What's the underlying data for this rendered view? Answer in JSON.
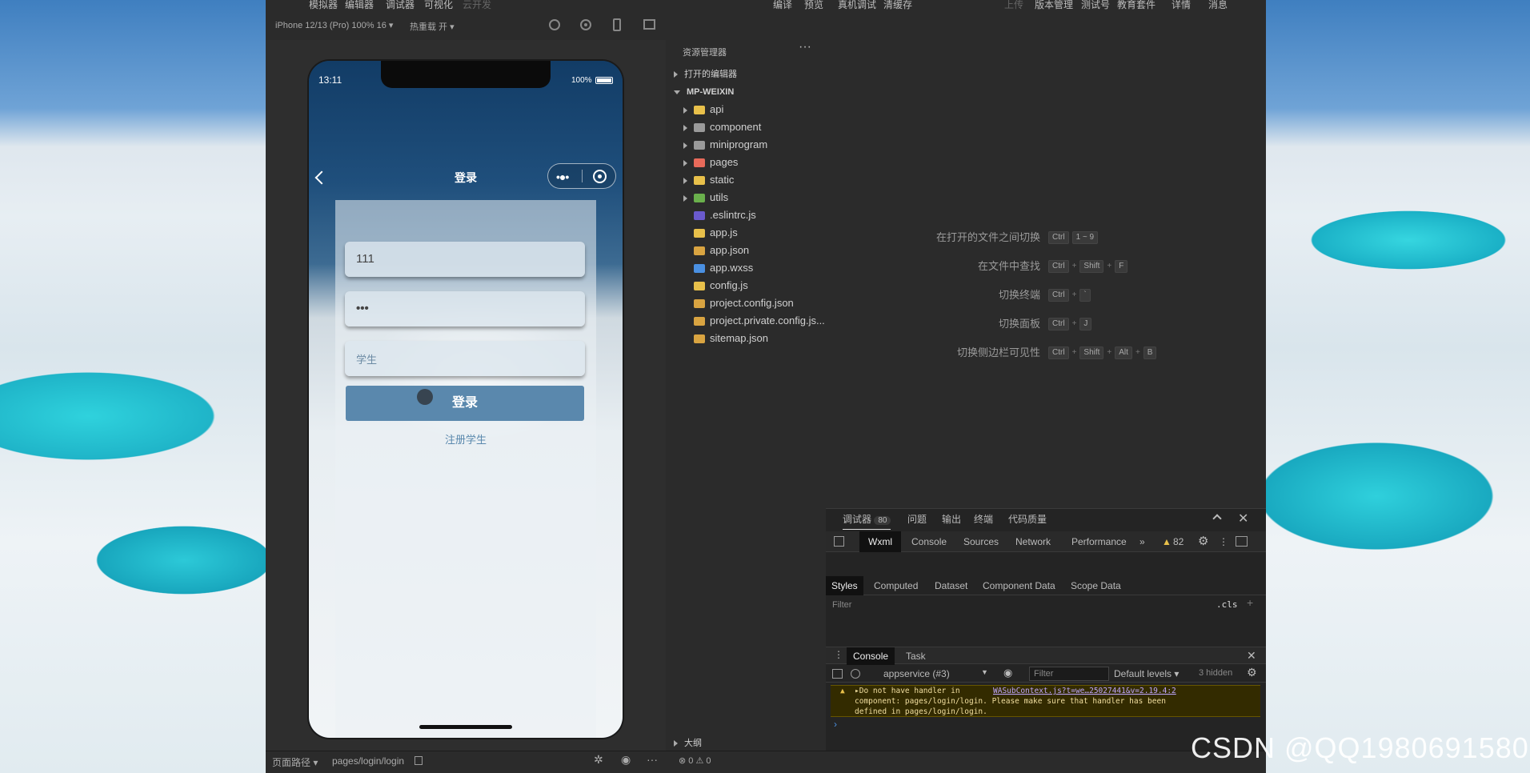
{
  "menubar": [
    "模拟器",
    "编辑器",
    "调试器",
    "可视化",
    "云开发",
    "编译",
    "预览",
    "真机调试",
    "清缓存",
    "上传",
    "版本管理",
    "测试号",
    "教育套件",
    "详情",
    "消息"
  ],
  "simbar": {
    "device": "iPhone 12/13 (Pro) 100% 16 ▾",
    "hotreload": "热重载 开 ▾"
  },
  "phone": {
    "time": "13:11",
    "battery": "100%",
    "title": "登录",
    "username": "111",
    "password": "•••",
    "role_placeholder": "学生",
    "login_button": "登录",
    "register_link": "注册学生"
  },
  "explorer": {
    "header": "资源管理器",
    "open_editors": "打开的编辑器",
    "project": "MP-WEIXIN",
    "outline": "大纲",
    "items": [
      {
        "name": "api",
        "type": "folder",
        "color": "#e8c04a"
      },
      {
        "name": "component",
        "type": "folder",
        "color": "#9a9a9a"
      },
      {
        "name": "miniprogram",
        "type": "folder",
        "color": "#9a9a9a"
      },
      {
        "name": "pages",
        "type": "folder",
        "color": "#e86a5a"
      },
      {
        "name": "static",
        "type": "folder",
        "color": "#e8c04a"
      },
      {
        "name": "utils",
        "type": "folder",
        "color": "#6ab04c"
      },
      {
        "name": ".eslintrc.js",
        "type": "file",
        "color": "#6a5acd"
      },
      {
        "name": "app.js",
        "type": "file",
        "color": "#e8c04a"
      },
      {
        "name": "app.json",
        "type": "file",
        "color": "#d9a441"
      },
      {
        "name": "app.wxss",
        "type": "file",
        "color": "#4a90e2"
      },
      {
        "name": "config.js",
        "type": "file",
        "color": "#e8c04a"
      },
      {
        "name": "project.config.json",
        "type": "file",
        "color": "#d9a441"
      },
      {
        "name": "project.private.config.js...",
        "type": "file",
        "color": "#d9a441"
      },
      {
        "name": "sitemap.json",
        "type": "file",
        "color": "#d9a441"
      }
    ],
    "status": "⊗ 0 ⚠ 0"
  },
  "shortcuts": [
    {
      "label": "在打开的文件之间切换",
      "keys": [
        "Ctrl",
        "1 ~ 9"
      ]
    },
    {
      "label": "在文件中查找",
      "keys": [
        "Ctrl",
        "+",
        "Shift",
        "+",
        "F"
      ]
    },
    {
      "label": "切换终端",
      "keys": [
        "Ctrl",
        "+",
        "`"
      ]
    },
    {
      "label": "切换面板",
      "keys": [
        "Ctrl",
        "+",
        "J"
      ]
    },
    {
      "label": "切换侧边栏可见性",
      "keys": [
        "Ctrl",
        "+",
        "Shift",
        "+",
        "Alt",
        "+",
        "B"
      ]
    }
  ],
  "devtools": {
    "top_tabs": [
      "调试器",
      "问题",
      "输出",
      "终端",
      "代码质量"
    ],
    "debugger_badge": "80",
    "tabs": [
      "Wxml",
      "Console",
      "Sources",
      "Network",
      "Performance"
    ],
    "more": "»",
    "warn_count": "82",
    "style_tabs": [
      "Styles",
      "Computed",
      "Dataset",
      "Component Data",
      "Scope Data"
    ],
    "filter_placeholder": "Filter",
    "cls": ".cls",
    "console_tabs": [
      "Console",
      "Task"
    ],
    "context": "appservice (#3)",
    "levels": "Default levels ▾",
    "hidden": "3 hidden",
    "warning_line1_a": "▸Do not have  handler in ",
    "warning_link": "WASubContext.js?t=we…25027441&v=2.19.4:2",
    "warning_line2": "component: pages/login/login. Please make sure that  handler has been",
    "warning_line3": "defined in pages/login/login."
  },
  "bottombar": {
    "path_label": "页面路径 ▾",
    "path": "pages/login/login"
  },
  "watermark": "CSDN @QQ1980691580"
}
